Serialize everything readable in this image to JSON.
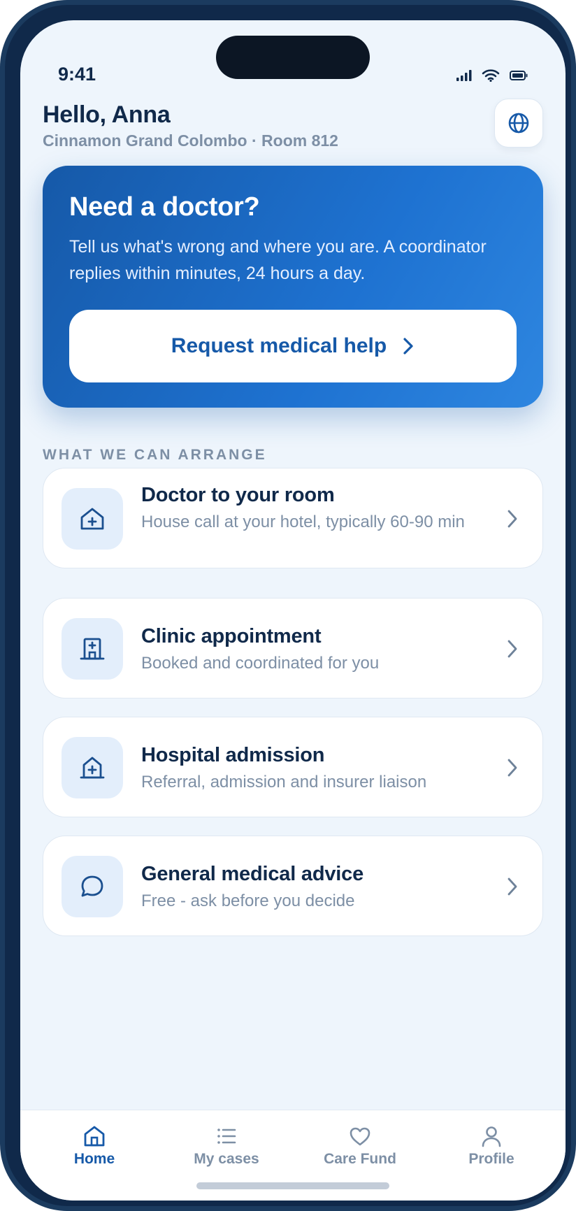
{
  "status_bar": {
    "time": "9:41"
  },
  "header": {
    "greeting": "Hello, Anna",
    "location": "Cinnamon Grand Colombo · Room 812",
    "language_icon": "globe-icon"
  },
  "hero": {
    "title": "Need a doctor?",
    "text": "Tell us what's wrong and where you are. A coordinator replies within minutes, 24 hours a day.",
    "button_label": "Request medical help"
  },
  "services": {
    "section_title": "WHAT WE CAN ARRANGE",
    "items": [
      {
        "title": "Doctor to your room",
        "description": "House call at your hotel, typically 60-90 min",
        "icon": "house-plus-icon"
      },
      {
        "title": "Clinic appointment",
        "description": "Booked and coordinated for you",
        "icon": "clinic-building-icon"
      },
      {
        "title": "Hospital admission",
        "description": "Referral, admission and insurer liaison",
        "icon": "hospital-icon"
      },
      {
        "title": "General medical advice",
        "description": "Free - ask before you decide",
        "icon": "chat-bubble-icon"
      }
    ]
  },
  "tab_bar": {
    "items": [
      {
        "label": "Home",
        "icon": "home-icon",
        "active": true
      },
      {
        "label": "My cases",
        "icon": "list-icon",
        "active": false
      },
      {
        "label": "Care Fund",
        "icon": "heart-icon",
        "active": false
      },
      {
        "label": "Profile",
        "icon": "person-icon",
        "active": false
      }
    ]
  },
  "colors": {
    "primary": "#1659a8",
    "text": "#10294a",
    "muted": "#7d8fa5",
    "background": "#eef5fc"
  }
}
